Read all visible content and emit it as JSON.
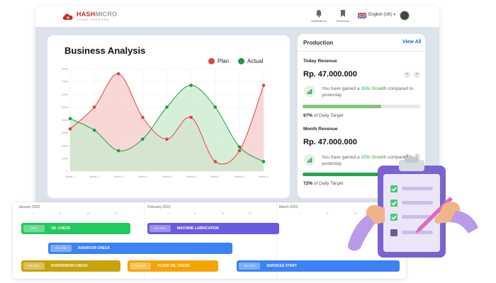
{
  "brand": {
    "name_part1": "HASH",
    "name_part2": "MICRO",
    "tagline": "THINK FORWARD"
  },
  "topbar": {
    "notifications_label": "Notifications",
    "bookmark_label": "Bookmark",
    "language": "English (UK)"
  },
  "chart_card": {
    "title": "Business Analysis",
    "legend": {
      "plan": "Plan",
      "actual": "Actual"
    }
  },
  "chart_data": {
    "type": "area",
    "title": "Business Analysis",
    "xlabel": "",
    "ylabel": "",
    "categories": [
      "Week 1",
      "Week 2",
      "Week 3",
      "Week 4",
      "Week 5",
      "Week 6",
      "Week 7",
      "Week 8",
      "Week 9"
    ],
    "y_ticks": [
      "0",
      "1000",
      "2000",
      "3000",
      "4000",
      "5000",
      "6000",
      "7000",
      "8000"
    ],
    "ylim": [
      0,
      8000
    ],
    "series": [
      {
        "name": "Plan",
        "color": "#e0443e",
        "fill": "#f6c9c9",
        "values": [
          3300,
          5000,
          7600,
          4200,
          2500,
          4200,
          750,
          1600,
          6700
        ]
      },
      {
        "name": "Actual",
        "color": "#1f9a3c",
        "fill": "#c9e9cc",
        "values": [
          4100,
          3200,
          1600,
          2500,
          5000,
          6700,
          5000,
          1900,
          750
        ]
      }
    ],
    "grid": true,
    "legend_position": "top-right"
  },
  "production": {
    "title": "Production",
    "view_all": "View All",
    "today": {
      "label": "Today Revenue",
      "amount": "Rp. 47.000.000",
      "growth_pre": "You have gained a ",
      "growth_highlight": "15% Growth",
      "growth_post": " compared to yesterday",
      "progress_percent": 67,
      "target_value": "67%",
      "target_text": " of Daily Target"
    },
    "month": {
      "label": "Month Revenue",
      "amount": "Rp. 47.000.000",
      "growth_pre": "You have gained a ",
      "growth_highlight": "15% Growth",
      "growth_post": " compared to yesterday",
      "progress_percent": 72,
      "target_value": "72%",
      "target_text": " of Daily Target"
    }
  },
  "gantt": {
    "months": [
      "January 2022",
      "February 2022",
      "March 2022"
    ],
    "days": [
      "1",
      "8",
      "15",
      "22",
      "1",
      "8",
      "15",
      "22",
      "1",
      "8",
      "15",
      "22"
    ],
    "tasks": [
      {
        "code": "EPH",
        "name": "OIL CHECK",
        "color": "#22c95e"
      },
      {
        "code": "PK-CHO",
        "name": "MACHINE LUBRICATION",
        "color": "#6a5ae0"
      },
      {
        "code": "PK-CHO",
        "name": "RADIATOR CHECK",
        "color": "#3b82f6"
      },
      {
        "code": "PK-CHO",
        "name": "SUSPENSION CHECK",
        "color": "#c8a20a"
      },
      {
        "code": "PK-CHO",
        "name": "FILTER OIL CHECK",
        "color": "#f5a300"
      },
      {
        "code": "PK-CHO",
        "name": "SERVICES START",
        "color": "#3b82f6"
      }
    ]
  },
  "colors": {
    "accent": "#1e63d6",
    "brand": "#c62828",
    "growth": "#2e9b4a"
  }
}
